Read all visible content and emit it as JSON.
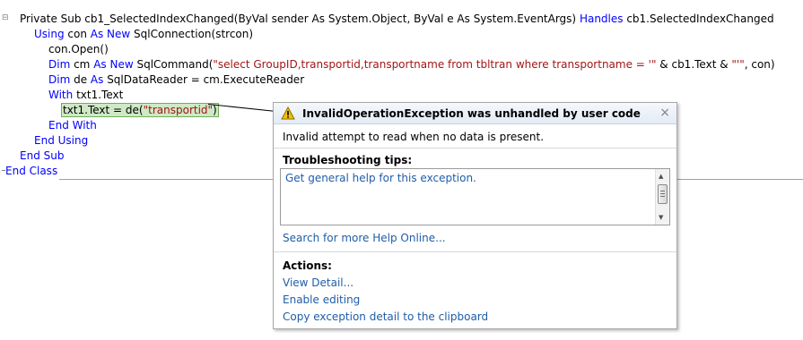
{
  "code": {
    "lines": [
      [
        {
          "t": "Private Sub cb1_SelectedIndexChanged(ByVal sender As System.Object, ByVal e As System.EventArgs) ",
          "c": "plain"
        },
        {
          "t": "Handles",
          "c": "kw"
        },
        {
          "t": " cb1.SelectedIndexChanged",
          "c": "plain"
        }
      ],
      [
        {
          "t": "Using",
          "c": "kw"
        },
        {
          "t": " con ",
          "c": "plain"
        },
        {
          "t": "As New",
          "c": "kw"
        },
        {
          "t": " SqlConnection(strcon)",
          "c": "plain"
        }
      ],
      [
        {
          "t": "con.Open()",
          "c": "plain"
        }
      ],
      [
        {
          "t": "Dim",
          "c": "kw"
        },
        {
          "t": " cm ",
          "c": "plain"
        },
        {
          "t": "As New",
          "c": "kw"
        },
        {
          "t": " SqlCommand(",
          "c": "plain"
        },
        {
          "t": "\"select GroupID,transportid,transportname from tbltran where transportname = '\"",
          "c": "str"
        },
        {
          "t": " & cb1.Text & ",
          "c": "plain"
        },
        {
          "t": "\"'\"",
          "c": "str"
        },
        {
          "t": ", con)",
          "c": "plain"
        }
      ],
      [
        {
          "t": "Dim",
          "c": "kw"
        },
        {
          "t": " de ",
          "c": "plain"
        },
        {
          "t": "As",
          "c": "kw"
        },
        {
          "t": " SqlDataReader = cm.ExecuteReader",
          "c": "plain"
        }
      ],
      [
        {
          "t": "With",
          "c": "kw"
        },
        {
          "t": " txt1.Text",
          "c": "plain"
        }
      ],
      [
        {
          "t": "txt1.Text = de(",
          "c": "plain"
        },
        {
          "t": "\"transportid\"",
          "c": "str"
        },
        {
          "t": ")",
          "c": "plain"
        }
      ],
      [
        {
          "t": "End With",
          "c": "kw"
        }
      ],
      [
        {
          "t": "End Using",
          "c": "kw"
        }
      ],
      [
        {
          "t": "End Sub",
          "c": "kw"
        }
      ],
      [
        {
          "t": "End Class",
          "c": "kw"
        }
      ]
    ]
  },
  "exception": {
    "title": "InvalidOperationException was unhandled by user code",
    "message": "Invalid attempt to read when no data is present.",
    "tips_heading": "Troubleshooting tips:",
    "tip": "Get general help for this exception.",
    "search_link": "Search for more Help Online...",
    "actions_heading": "Actions:",
    "actions": [
      "View Detail...",
      "Enable editing",
      "Copy exception detail to the clipboard"
    ],
    "close_glyph": "×"
  },
  "colors": {
    "keyword": "#0000ff",
    "string": "#a31515",
    "link": "#1f5da8",
    "highlight": "#cfe9c6",
    "warning": "#f2c200"
  },
  "icons": {
    "warning": "warning-icon",
    "close": "close-icon",
    "collapse": "collapse-icon"
  }
}
